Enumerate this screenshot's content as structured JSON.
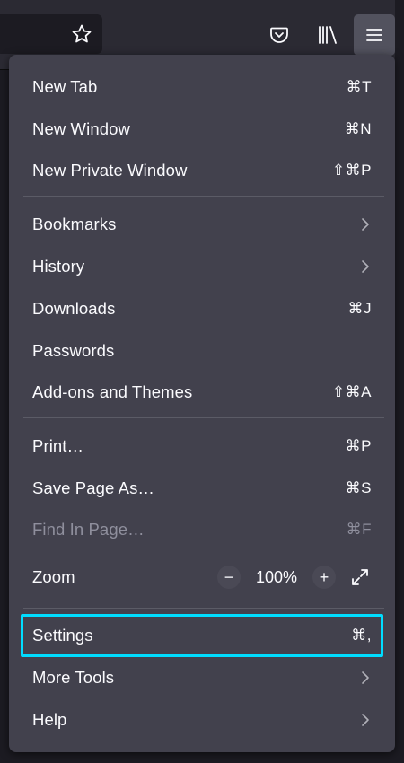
{
  "toolbar": {
    "icons": [
      "star-icon",
      "pocket-icon",
      "library-icon",
      "hamburger-menu-icon"
    ]
  },
  "menu": {
    "group1": [
      {
        "label": "New Tab",
        "shortcut": "⌘T"
      },
      {
        "label": "New Window",
        "shortcut": "⌘N"
      },
      {
        "label": "New Private Window",
        "shortcut": "⇧⌘P"
      }
    ],
    "group2": [
      {
        "label": "Bookmarks",
        "shortcut": ""
      },
      {
        "label": "History",
        "shortcut": ""
      },
      {
        "label": "Downloads",
        "shortcut": "⌘J"
      },
      {
        "label": "Passwords",
        "shortcut": ""
      },
      {
        "label": "Add-ons and Themes",
        "shortcut": "⇧⌘A"
      }
    ],
    "group3": [
      {
        "label": "Print…",
        "shortcut": "⌘P"
      },
      {
        "label": "Save Page As…",
        "shortcut": "⌘S"
      },
      {
        "label": "Find In Page…",
        "shortcut": "⌘F",
        "disabled": true
      }
    ],
    "zoom": {
      "label": "Zoom",
      "minus": "−",
      "value": "100%",
      "plus": "+"
    },
    "group4": [
      {
        "label": "Settings",
        "shortcut": "⌘,"
      },
      {
        "label": "More Tools",
        "shortcut": ""
      },
      {
        "label": "Help",
        "shortcut": ""
      }
    ]
  },
  "colors": {
    "panel": "#42414d",
    "toolbar": "#2b2a33",
    "highlight": "#00ddff",
    "text": "#fbfbfe",
    "disabled_text": "#8f8f9d"
  }
}
